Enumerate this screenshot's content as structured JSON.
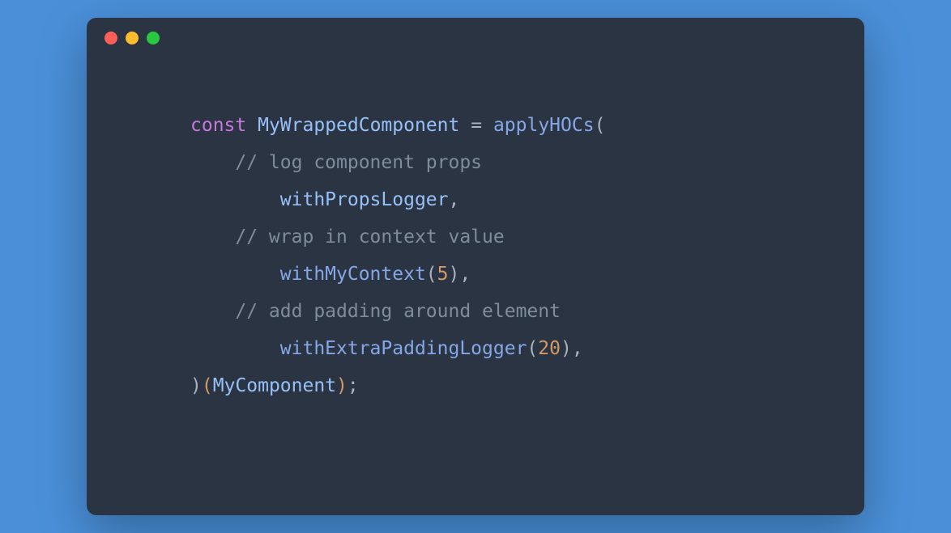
{
  "colors": {
    "background": "#4a90d9",
    "window_bg": "#2b3442",
    "keyword": "#c678dd",
    "identifier": "#96c0f7",
    "function": "#86a7e7",
    "punctuation": "#abb2bf",
    "comment": "#7f8c9b",
    "number": "#d19a66"
  },
  "traffic_lights": {
    "red": "#ff5f57",
    "yellow": "#febc2e",
    "green": "#28c840"
  },
  "code": {
    "line1": {
      "keyword": "const",
      "space1": " ",
      "varname": "MyWrappedComponent",
      "space2": " ",
      "equals": "=",
      "space3": " ",
      "func": "applyHOCs",
      "paren": "("
    },
    "line2": {
      "indent": "    ",
      "comment": "// log component props"
    },
    "line3": {
      "indent": "        ",
      "ident": "withPropsLogger",
      "comma": ","
    },
    "line4": {
      "indent": "    ",
      "comment": "// wrap in context value"
    },
    "line5": {
      "indent": "        ",
      "func": "withMyContext",
      "lparen": "(",
      "num": "5",
      "rparen": ")",
      "comma": ","
    },
    "line6": {
      "indent": "    ",
      "comment": "// add padding around element"
    },
    "line7": {
      "indent": "        ",
      "func": "withExtraPaddingLogger",
      "lparen": "(",
      "num": "20",
      "rparen": ")",
      "comma": ","
    },
    "line8": {
      "rparen1": ")",
      "lparen2": "(",
      "ident": "MyComponent",
      "rparen2": ")",
      "semi": ";"
    }
  }
}
